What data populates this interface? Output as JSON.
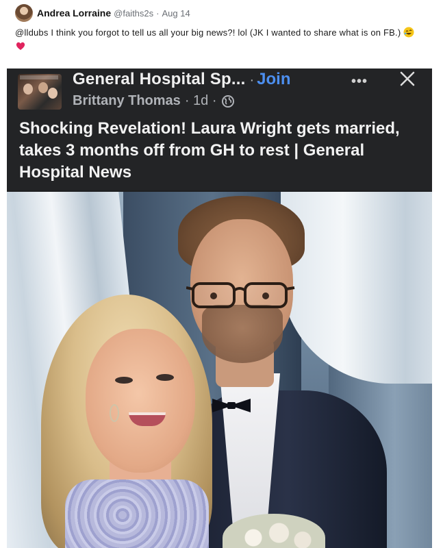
{
  "tweet": {
    "author_name": "Andrea Lorraine",
    "handle": "@faiths2s",
    "separator": "·",
    "date": "Aug 14",
    "text": "@lldubs I think you forgot to tell us all your big news?! lol (JK I wanted to share what is on FB.)",
    "emojis": [
      "rolling-on-floor-laughing-emoji",
      "red-heart-emoji"
    ],
    "colors": {
      "heart": "#e0245e",
      "laugh": "#f5b900"
    }
  },
  "fb_post": {
    "group_name": "General Hospital Sp...",
    "separator": "·",
    "join_label": "Join",
    "more_label": "•••",
    "author": "Brittany Thomas",
    "time": "· 1d ·",
    "audience_icon": "globe-icon",
    "headline": "Shocking Revelation! Laura Wright gets married, takes 3 months off from GH to rest | General Hospital News",
    "colors": {
      "background": "#232426",
      "join": "#4c8ff0",
      "text": "#f2f2f2",
      "meta": "#b0b3b8"
    }
  }
}
